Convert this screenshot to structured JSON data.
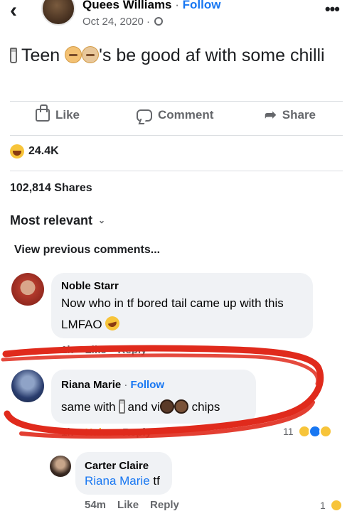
{
  "header": {
    "back_icon": "chevron-left-icon",
    "author": "Quees Williams",
    "separator": "·",
    "follow": "Follow",
    "date": "Oct 24, 2020 ·",
    "more_icon": "ellipsis-icon"
  },
  "post": {
    "text_part1": "Teen",
    "text_part2": "'s be good af with some chilli"
  },
  "actions": {
    "like": "Like",
    "comment": "Comment",
    "share": "Share"
  },
  "reactions": {
    "count": "24.4K"
  },
  "shares": "102,814 Shares",
  "sort": {
    "label": "Most relevant"
  },
  "view_previous": "View previous comments...",
  "comments": [
    {
      "name": "Noble Starr",
      "text_line1": "Now who in tf bored tail came up with this",
      "text_line2": "LMFAO",
      "time": "1h",
      "like": "Like",
      "reply": "Reply"
    },
    {
      "name": "Riana Marie",
      "separator": "·",
      "follow": "Follow",
      "text_part1": "same with",
      "text_part2": "and vi",
      "text_part3": "chips",
      "time": "1h",
      "reaction_label": "Haha",
      "reply": "Reply",
      "reaction_count": "11"
    },
    {
      "name": "Carter Claire",
      "mention": "Riana Marie",
      "text": "tf",
      "time": "54m",
      "like": "Like",
      "reply": "Reply",
      "reaction_count": "1"
    }
  ],
  "colors": {
    "accent": "#1877f2",
    "haha": "#f0b22a",
    "annotation": "#e02a1c"
  }
}
